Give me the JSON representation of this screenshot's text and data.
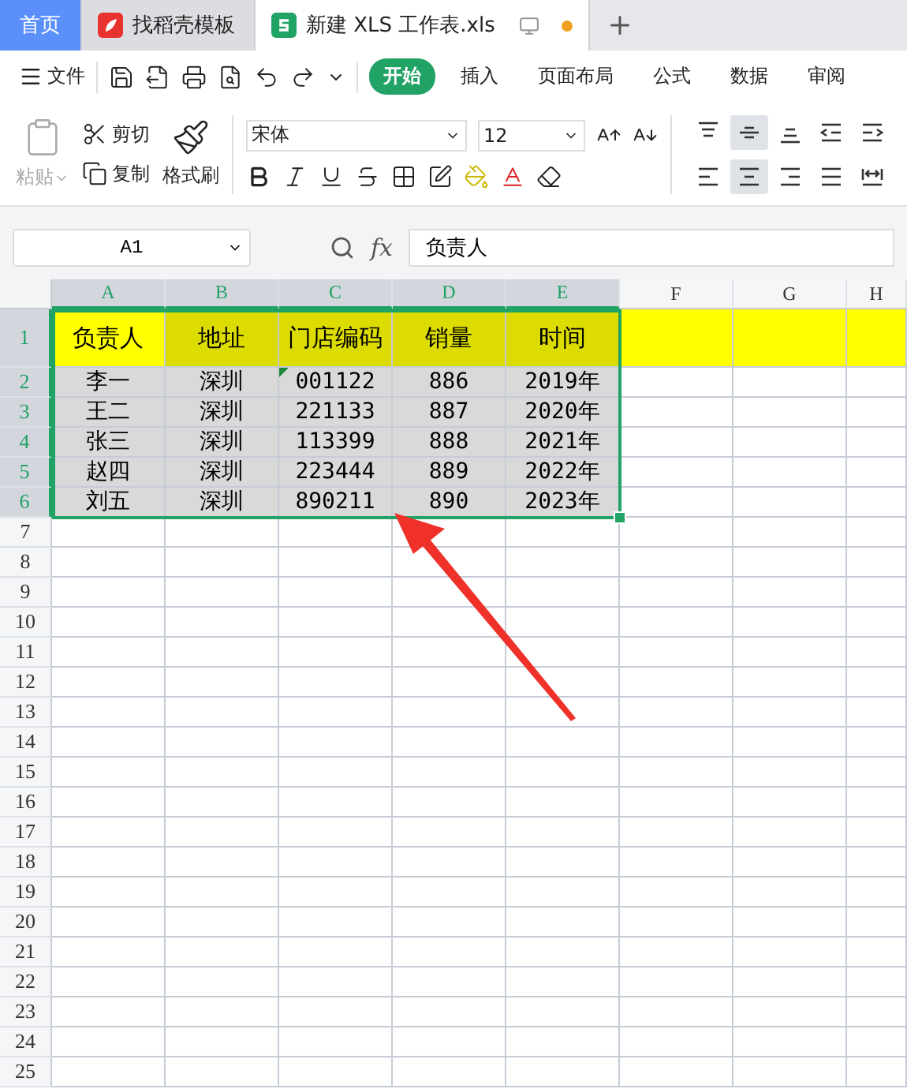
{
  "tabs": [
    {
      "label": "首页",
      "kind": "home",
      "selected": false
    },
    {
      "label": "找稻壳模板",
      "kind": "template",
      "selected": false
    },
    {
      "label": "新建 XLS 工作表.xls",
      "kind": "sheet",
      "selected": true,
      "unsaved": true
    }
  ],
  "menu": {
    "file": "文件",
    "items": [
      {
        "label": "开始",
        "selected": true
      },
      {
        "label": "插入",
        "selected": false
      },
      {
        "label": "页面布局",
        "selected": false
      },
      {
        "label": "公式",
        "selected": false
      },
      {
        "label": "数据",
        "selected": false
      },
      {
        "label": "审阅",
        "selected": false
      }
    ]
  },
  "ribbon": {
    "paste": {
      "label": "粘贴",
      "disabled": true
    },
    "cut": "剪切",
    "copy": "复制",
    "format_painter": "格式刷",
    "font": "宋体",
    "font_size": "12",
    "align_buttons": [
      {
        "kind": "top",
        "selected": false
      },
      {
        "kind": "middle",
        "selected": true
      },
      {
        "kind": "bottom",
        "selected": false
      },
      {
        "kind": "outdent",
        "selected": false
      },
      {
        "kind": "indent",
        "selected": false
      },
      {
        "kind": "left",
        "selected": false
      },
      {
        "kind": "center",
        "selected": true
      },
      {
        "kind": "right",
        "selected": false
      },
      {
        "kind": "justify",
        "selected": false
      },
      {
        "kind": "distributed",
        "selected": false
      }
    ]
  },
  "formula_bar": {
    "name_box": "A1",
    "fx": "fx",
    "value": "负责人"
  },
  "sheet": {
    "columns": [
      {
        "label": "A",
        "selected": true
      },
      {
        "label": "B",
        "selected": true
      },
      {
        "label": "C",
        "selected": true
      },
      {
        "label": "D",
        "selected": true
      },
      {
        "label": "E",
        "selected": true
      },
      {
        "label": "F",
        "selected": false
      },
      {
        "label": "G",
        "selected": false
      },
      {
        "label": "H",
        "selected": false
      }
    ],
    "rows": [
      {
        "number": "1",
        "selected": true,
        "highlighted": true,
        "cells": [
          {
            "text": "负责人",
            "active": true
          },
          {
            "text": "地址"
          },
          {
            "text": "门店编码"
          },
          {
            "text": "销量"
          },
          {
            "text": "时间"
          }
        ]
      },
      {
        "number": "2",
        "selected": true,
        "highlighted": false,
        "cells": [
          {
            "text": "李一"
          },
          {
            "text": "深圳"
          },
          {
            "text": "001122",
            "error_mark": true
          },
          {
            "text": "886"
          },
          {
            "text": "2019年"
          }
        ]
      },
      {
        "number": "3",
        "selected": true,
        "highlighted": false,
        "cells": [
          {
            "text": "王二"
          },
          {
            "text": "深圳"
          },
          {
            "text": "221133"
          },
          {
            "text": "887"
          },
          {
            "text": "2020年"
          }
        ]
      },
      {
        "number": "4",
        "selected": true,
        "highlighted": false,
        "cells": [
          {
            "text": "张三"
          },
          {
            "text": "深圳"
          },
          {
            "text": "113399"
          },
          {
            "text": "888"
          },
          {
            "text": "2021年"
          }
        ]
      },
      {
        "number": "5",
        "selected": true,
        "highlighted": false,
        "cells": [
          {
            "text": "赵四"
          },
          {
            "text": "深圳"
          },
          {
            "text": "223444"
          },
          {
            "text": "889"
          },
          {
            "text": "2022年"
          }
        ]
      },
      {
        "number": "6",
        "selected": true,
        "highlighted": false,
        "cells": [
          {
            "text": "刘五"
          },
          {
            "text": "深圳"
          },
          {
            "text": "890211"
          },
          {
            "text": "890"
          },
          {
            "text": "2023年"
          }
        ]
      },
      {
        "number": "7",
        "selected": false,
        "highlighted": false
      },
      {
        "number": "8",
        "selected": false,
        "highlighted": false
      },
      {
        "number": "9",
        "selected": false,
        "highlighted": false
      },
      {
        "number": "10",
        "selected": false,
        "highlighted": false
      },
      {
        "number": "11",
        "selected": false,
        "highlighted": false
      },
      {
        "number": "12",
        "selected": false,
        "highlighted": false
      },
      {
        "number": "13",
        "selected": false,
        "highlighted": false
      },
      {
        "number": "14",
        "selected": false,
        "highlighted": false
      },
      {
        "number": "15",
        "selected": false,
        "highlighted": false
      },
      {
        "number": "16",
        "selected": false,
        "highlighted": false
      },
      {
        "number": "17",
        "selected": false,
        "highlighted": false
      },
      {
        "number": "18",
        "selected": false,
        "highlighted": false
      },
      {
        "number": "19",
        "selected": false,
        "highlighted": false
      },
      {
        "number": "20",
        "selected": false,
        "highlighted": false
      },
      {
        "number": "21",
        "selected": false,
        "highlighted": false
      },
      {
        "number": "22",
        "selected": false,
        "highlighted": false
      },
      {
        "number": "23",
        "selected": false,
        "highlighted": false
      },
      {
        "number": "24",
        "selected": false,
        "highlighted": false
      },
      {
        "number": "25",
        "selected": false,
        "highlighted": false
      }
    ]
  }
}
